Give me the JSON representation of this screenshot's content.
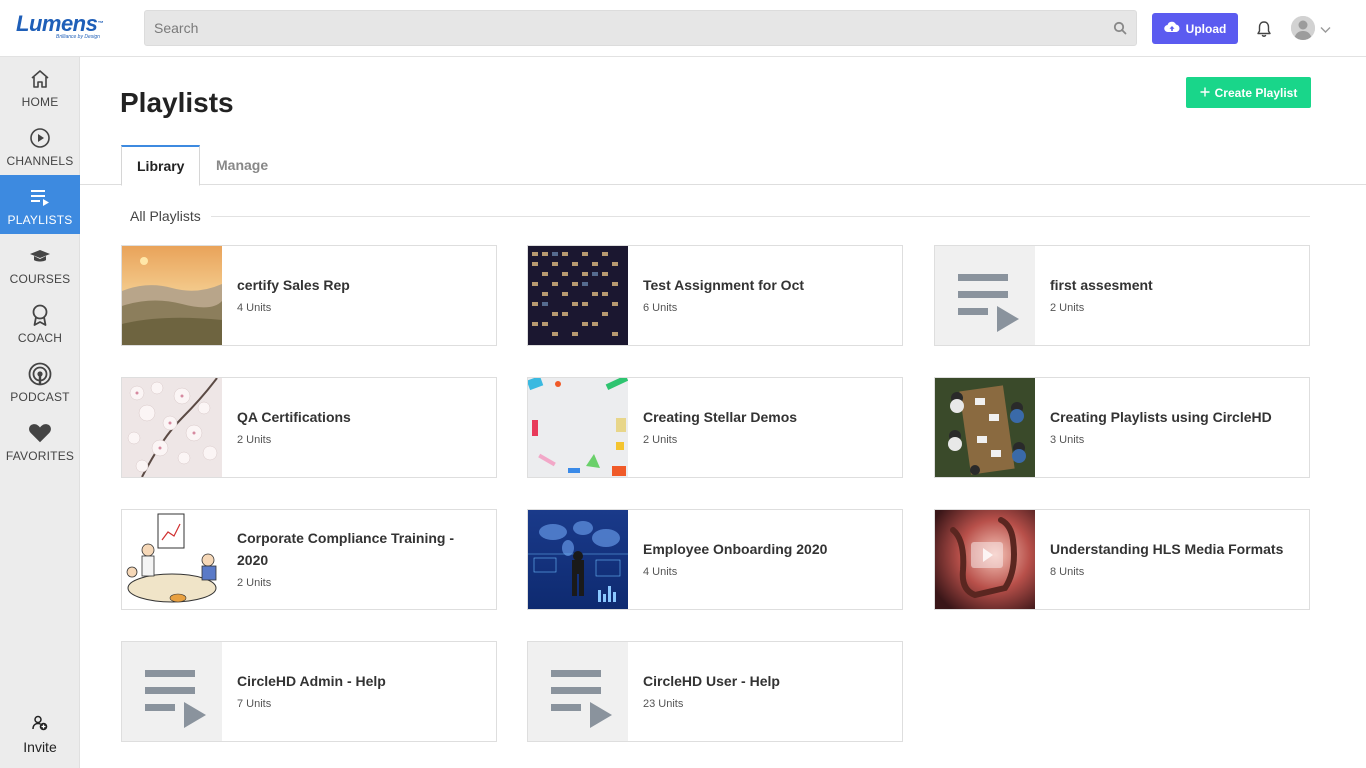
{
  "brand": {
    "name": "Lumens",
    "tagline": "Brilliance by Design",
    "trademark": "™"
  },
  "search": {
    "placeholder": "Search"
  },
  "header": {
    "upload_label": "Upload"
  },
  "sidebar": {
    "items": [
      {
        "label": "HOME",
        "icon": "home-icon"
      },
      {
        "label": "CHANNELS",
        "icon": "play-circle-icon"
      },
      {
        "label": "PLAYLISTS",
        "icon": "playlist-icon",
        "active": true
      },
      {
        "label": "COURSES",
        "icon": "graduation-cap-icon"
      },
      {
        "label": "COACH",
        "icon": "award-ribbon-icon"
      },
      {
        "label": "PODCAST",
        "icon": "podcast-icon"
      },
      {
        "label": "FAVORITES",
        "icon": "heart-icon"
      }
    ],
    "invite_label": "Invite"
  },
  "page": {
    "title": "Playlists",
    "create_label": "Create Playlist",
    "tabs": [
      {
        "label": "Library",
        "active": true
      },
      {
        "label": "Manage",
        "active": false
      }
    ],
    "section_title": "All Playlists"
  },
  "playlists": [
    {
      "title": "certify Sales Rep",
      "units": "4 Units",
      "thumb": "sunset-landscape"
    },
    {
      "title": "Test Assignment for Oct",
      "units": "6 Units",
      "thumb": "night-building"
    },
    {
      "title": "first assesment",
      "units": "2 Units",
      "thumb": "playlist-placeholder"
    },
    {
      "title": "QA Certifications",
      "units": "2 Units",
      "thumb": "cherry-blossoms"
    },
    {
      "title": "Creating Stellar Demos",
      "units": "2 Units",
      "thumb": "desk-stationery"
    },
    {
      "title": "Creating Playlists using CircleHD",
      "units": "3 Units",
      "thumb": "meeting-table"
    },
    {
      "title": "Corporate Compliance Training - 2020",
      "units": "2 Units",
      "thumb": "cartoon-meeting"
    },
    {
      "title": "Employee Onboarding 2020",
      "units": "4 Units",
      "thumb": "world-map-screen"
    },
    {
      "title": "Understanding HLS Media Formats",
      "units": "8 Units",
      "thumb": "hands-frame"
    },
    {
      "title": "CircleHD Admin - Help",
      "units": "7 Units",
      "thumb": "playlist-placeholder"
    },
    {
      "title": "CircleHD User - Help",
      "units": "23 Units",
      "thumb": "playlist-placeholder"
    }
  ],
  "colors": {
    "accent": "#3d8ae0",
    "upload": "#5b5bf0",
    "create": "#19d68a",
    "sidebar_bg": "#ececec"
  }
}
